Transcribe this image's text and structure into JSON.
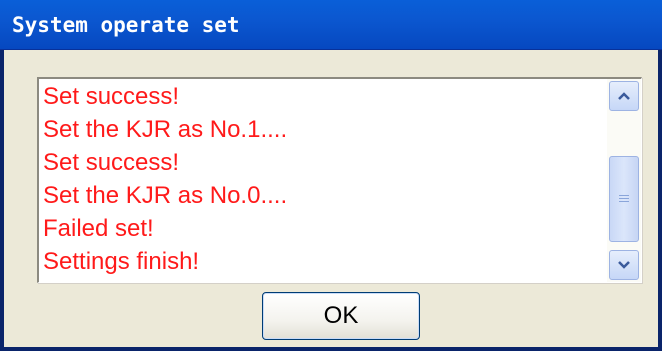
{
  "window": {
    "title": "System operate set"
  },
  "log": {
    "lines": [
      "Set success!",
      "Set the KJR as No.1....",
      "Set success!",
      "Set the KJR as No.0....",
      "Failed set!",
      "Settings finish!"
    ],
    "text_color": "#ff1a1a"
  },
  "scrollbar": {
    "up_icon": "chevron-up-icon",
    "down_icon": "chevron-down-icon",
    "thumb_icon": "grip-icon"
  },
  "buttons": {
    "ok_label": "OK"
  },
  "colors": {
    "titlebar": "#0b57d0",
    "dialog_bg": "#ece9d8",
    "list_bg": "#ffffff"
  }
}
